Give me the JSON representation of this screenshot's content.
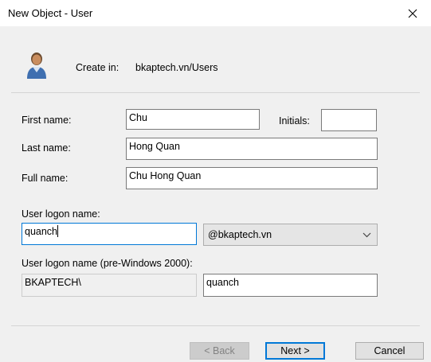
{
  "window": {
    "title": "New Object - User"
  },
  "header": {
    "create_in_label": "Create in:",
    "create_in_path": "bkaptech.vn/Users"
  },
  "form": {
    "first_name_label": "First name:",
    "first_name_value": "Chu",
    "initials_label": "Initials:",
    "initials_value": "",
    "last_name_label": "Last name:",
    "last_name_value": "Hong Quan",
    "full_name_label": "Full name:",
    "full_name_value": "Chu Hong Quan",
    "logon_name_label": "User logon name:",
    "logon_name_value": "quanch",
    "domain_selected": "@bkaptech.vn",
    "pre2000_label": "User logon name (pre-Windows 2000):",
    "pre2000_domain": "BKAPTECH\\",
    "pre2000_value": "quanch"
  },
  "buttons": {
    "back": "< Back",
    "next": "Next >",
    "cancel": "Cancel"
  },
  "icons": {
    "user": "user-icon",
    "close": "close-icon",
    "dropdown": "chevron-down-icon"
  },
  "colors": {
    "focus_border": "#0078d7",
    "panel_bg": "#f0f0f0"
  }
}
